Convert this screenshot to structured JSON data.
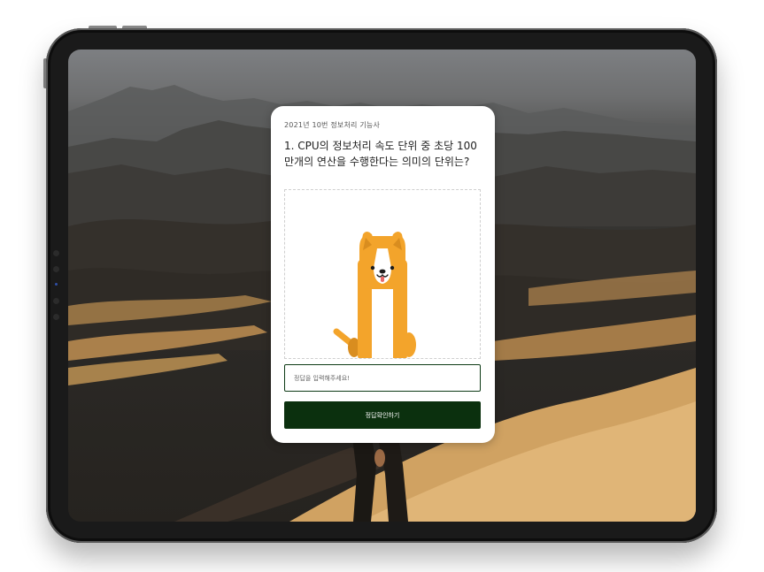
{
  "quiz": {
    "exam_label": "2021년 10번  정보처리 기능사",
    "question": "1. CPU의 정보처리 속도 단위 중 초당 100만개의 연산을 수행한다는 의미의 단위는?",
    "answer_input": {
      "placeholder": "정답을 입력해주세요!",
      "value": ""
    },
    "submit_label": "정답확인하기"
  },
  "colors": {
    "button_bg": "#0b300e",
    "input_border": "#0e3b16",
    "dog_orange": "#f3a42b",
    "dog_belly": "#ffffff"
  },
  "icons": {
    "mascot": "dog-mascot-icon"
  }
}
